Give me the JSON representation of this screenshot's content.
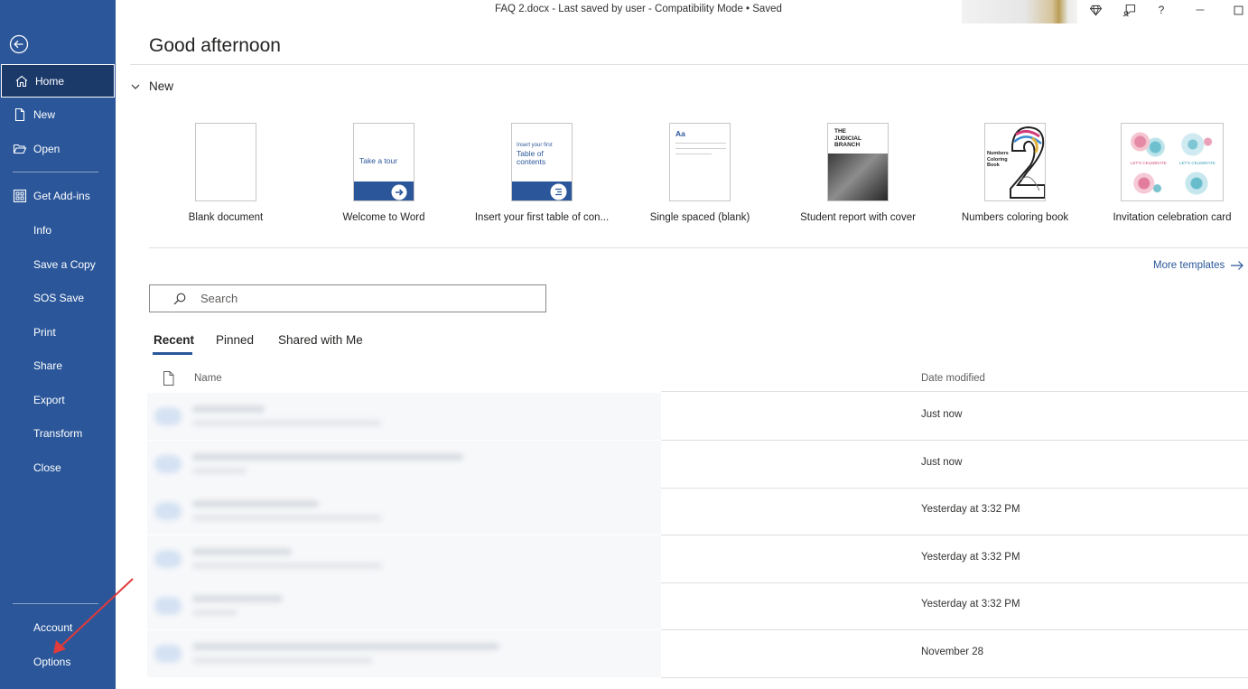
{
  "titlebar": {
    "document_info": "FAQ 2.docx  -  Last saved by user  -  Compatibility Mode • Saved",
    "help_label": "?"
  },
  "sidebar": {
    "back_icon": "back-arrow-icon",
    "top_items": [
      {
        "label": "Home",
        "icon": "home-icon",
        "active": true
      },
      {
        "label": "New",
        "icon": "new-document-icon"
      },
      {
        "label": "Open",
        "icon": "folder-open-icon"
      }
    ],
    "mid_items": [
      {
        "label": "Get Add-ins",
        "icon": "add-ins-grid-icon"
      },
      {
        "label": "Info"
      },
      {
        "label": "Save a Copy"
      },
      {
        "label": "SOS Save"
      },
      {
        "label": "Print"
      },
      {
        "label": "Share"
      },
      {
        "label": "Export"
      },
      {
        "label": "Transform"
      },
      {
        "label": "Close"
      }
    ],
    "bottom_items": [
      {
        "label": "Account"
      },
      {
        "label": "Options"
      }
    ]
  },
  "main": {
    "greeting": "Good afternoon",
    "new_section_label": "New",
    "templates": [
      {
        "label": "Blank document"
      },
      {
        "label": "Welcome to Word",
        "thumb_text": "Take a tour"
      },
      {
        "label": "Insert your first table of con...",
        "thumb_text_small": "Insert your first",
        "thumb_text_big": "Table of contents"
      },
      {
        "label": "Single spaced (blank)",
        "thumb_text": "Aa"
      },
      {
        "label": "Student report with cover",
        "thumb_text": "THE JUDICIAL BRANCH"
      },
      {
        "label": "Numbers coloring book",
        "thumb_text": "Numbers Coloring Book"
      },
      {
        "label": "Invitation celebration card",
        "thumb_text": "LET'S CELEBRATE"
      }
    ],
    "more_templates": "More templates",
    "search_placeholder": "Search",
    "tabs": [
      "Recent",
      "Pinned",
      "Shared with Me"
    ],
    "columns": {
      "name": "Name",
      "date": "Date modified"
    },
    "files": [
      {
        "date": "Just now"
      },
      {
        "date": "Just now"
      },
      {
        "date": "Yesterday at 3:32 PM"
      },
      {
        "date": "Yesterday at 3:32 PM"
      },
      {
        "date": "Yesterday at 3:32 PM"
      },
      {
        "date": "November 28"
      }
    ]
  },
  "colors": {
    "sidebar_bg": "#2b579a",
    "accent": "#2b579a",
    "annotation_arrow": "#e03a3a"
  }
}
